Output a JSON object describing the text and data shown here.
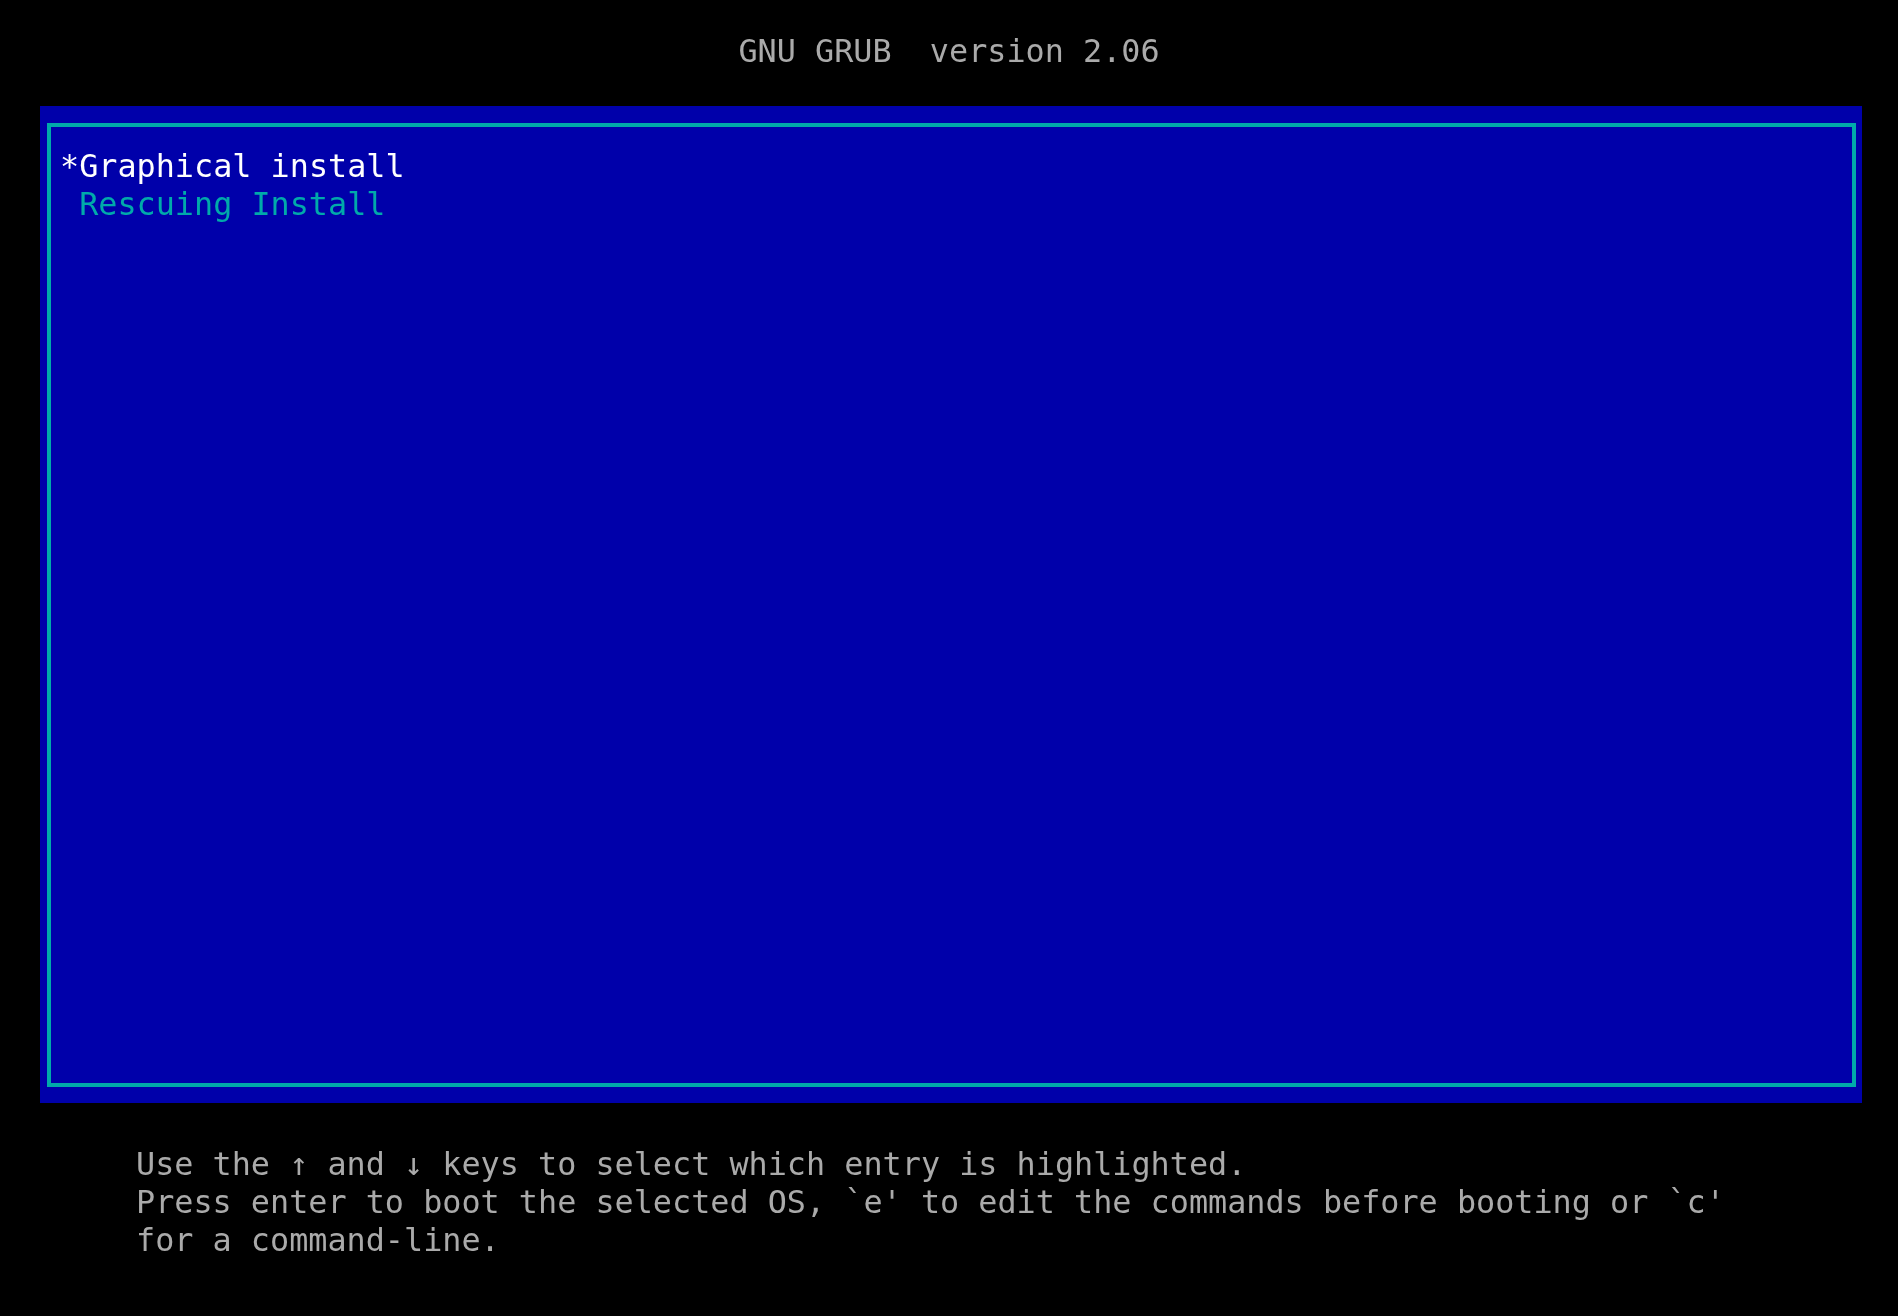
{
  "header": {
    "title": "GNU GRUB  version 2.06"
  },
  "menu": {
    "selection_marker": "*",
    "entries": [
      {
        "label": "Graphical install",
        "selected": true
      },
      {
        "label": "Rescuing Install",
        "selected": false
      }
    ]
  },
  "help": [
    "Use the ↑ and ↓ keys to select which entry is highlighted.",
    "Press enter to boot the selected OS, `e' to edit the commands before booting or `c' for a command-line."
  ]
}
